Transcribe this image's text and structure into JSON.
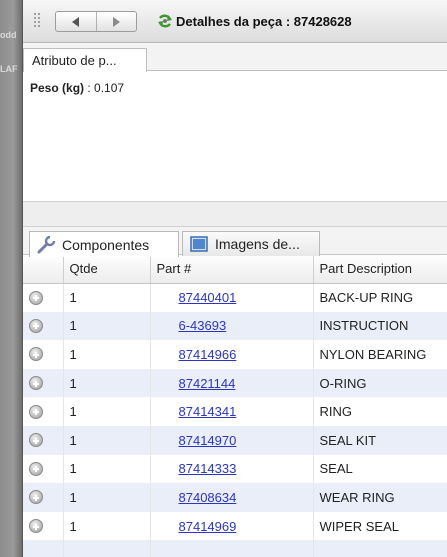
{
  "window": {
    "title": "Detalhes da peça : 87428628"
  },
  "attributes": {
    "tab_label": "Atributo de p...",
    "weight_label": "Peso",
    "weight_unit": "(kg)",
    "weight_separator": ": 0.107"
  },
  "tabs": [
    {
      "label": "Componentes",
      "icon": "wrench-icon",
      "active": true
    },
    {
      "label": "Imagens de...",
      "icon": "image-icon",
      "active": false
    }
  ],
  "grid": {
    "columns": [
      "",
      "Qtde",
      "Part #",
      "Part Description"
    ],
    "rows": [
      {
        "qty": "1",
        "part": "87440401",
        "desc": "BACK-UP RING"
      },
      {
        "qty": "1",
        "part": "6-43693",
        "desc": "INSTRUCTION"
      },
      {
        "qty": "1",
        "part": "87414966",
        "desc": "NYLON BEARING"
      },
      {
        "qty": "1",
        "part": "87421144",
        "desc": "O-RING"
      },
      {
        "qty": "1",
        "part": "87414341",
        "desc": "RING"
      },
      {
        "qty": "1",
        "part": "87414970",
        "desc": "SEAL KIT"
      },
      {
        "qty": "1",
        "part": "87414333",
        "desc": "SEAL"
      },
      {
        "qty": "1",
        "part": "87408634",
        "desc": "WEAR RING"
      },
      {
        "qty": "1",
        "part": "87414969",
        "desc": "WIPER SEAL"
      }
    ]
  },
  "backdrop_labels": [
    "odd",
    "LAF"
  ],
  "colors": {
    "link": "#2a35c8",
    "row_alt": "#e9eef8"
  }
}
